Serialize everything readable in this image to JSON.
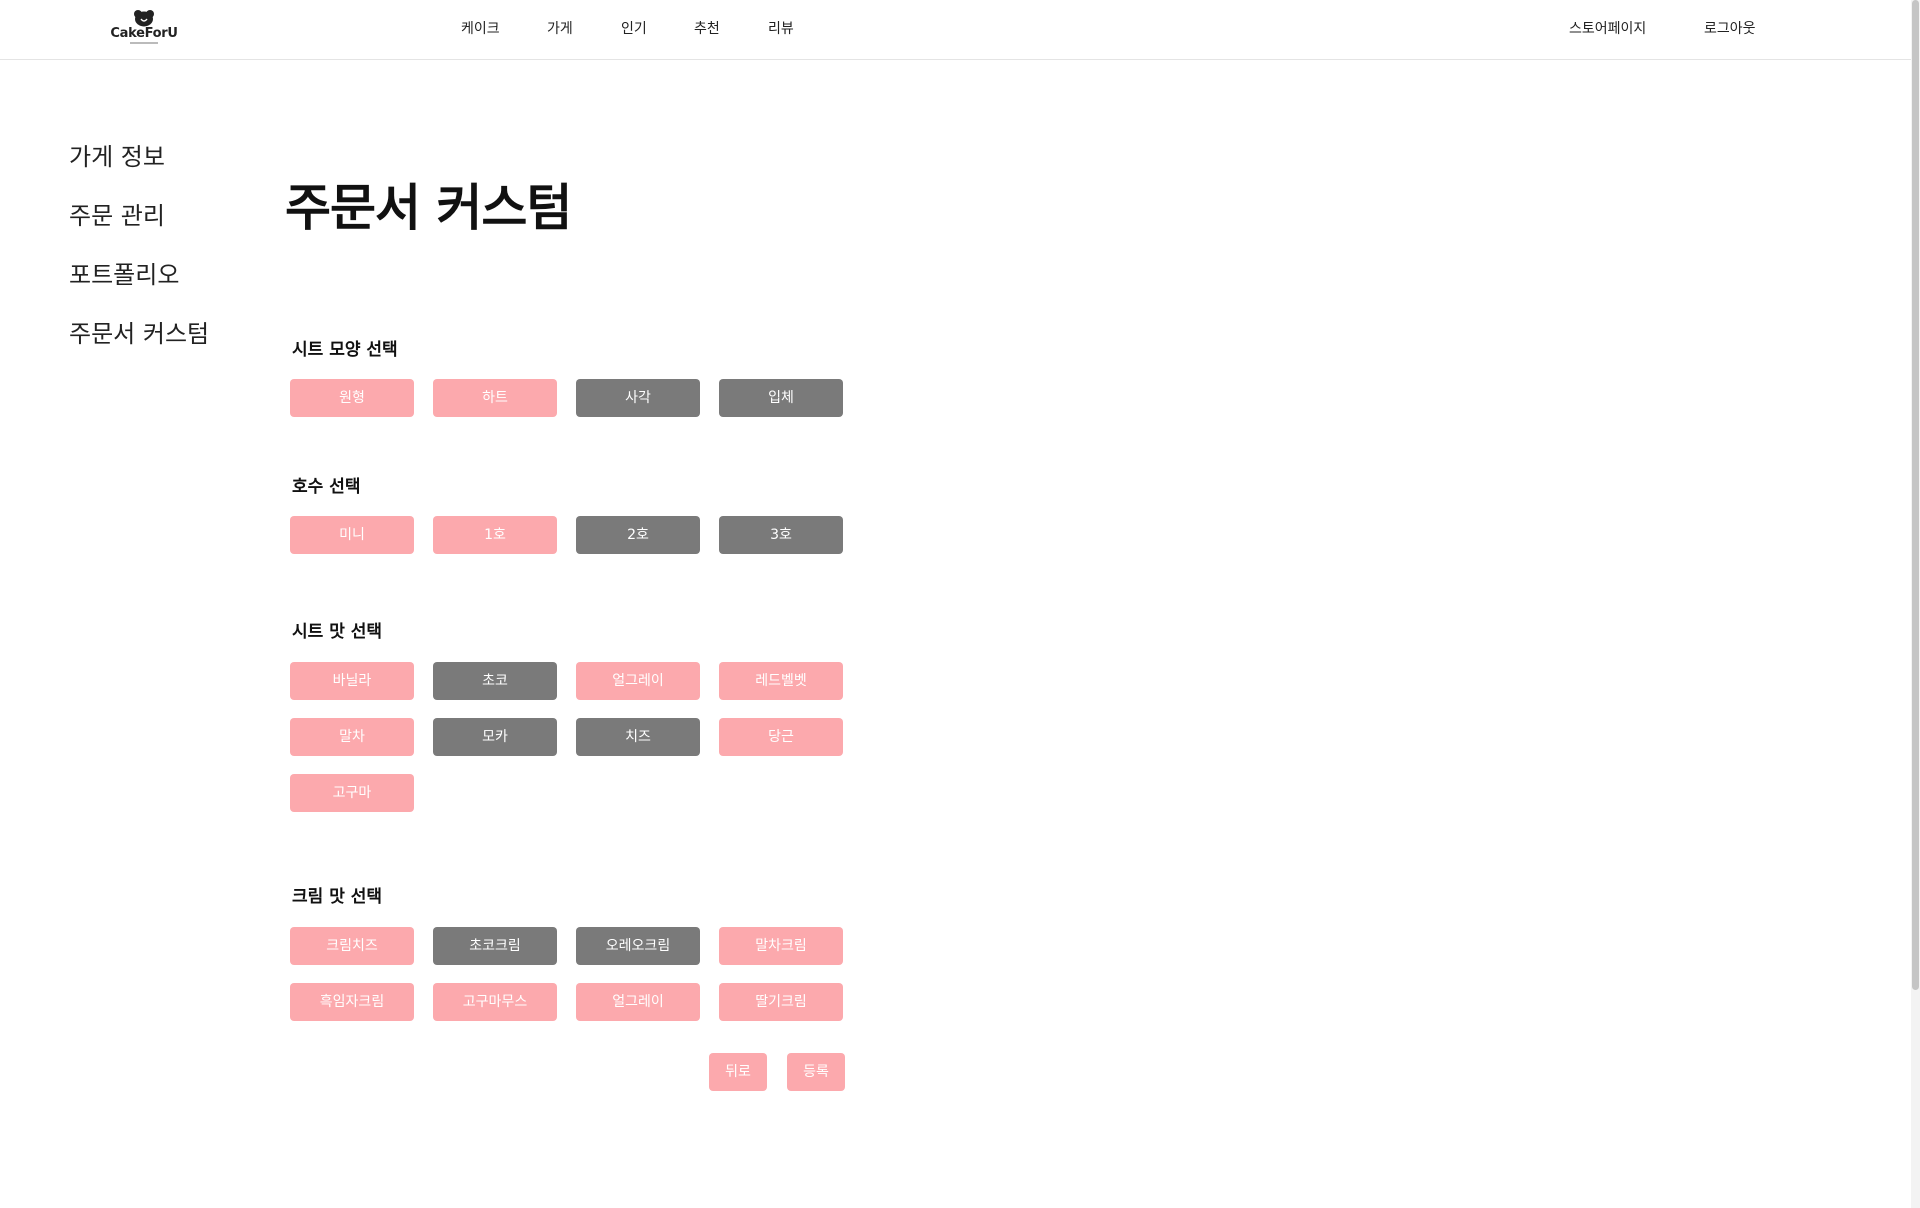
{
  "header": {
    "logo_text": "CakeForU",
    "nav": [
      "케이크",
      "가게",
      "인기",
      "추천",
      "리뷰"
    ],
    "store_page": "스토어페이지",
    "logout": "로그아웃"
  },
  "sidebar": {
    "items": [
      {
        "label": "가게 정보"
      },
      {
        "label": "주문 관리"
      },
      {
        "label": "포트폴리오"
      },
      {
        "label": "주문서 커스텀"
      }
    ]
  },
  "main": {
    "title": "주문서 커스텀",
    "sections": [
      {
        "title": "시트 모양 선택",
        "options": [
          {
            "label": "원형",
            "state": "pink"
          },
          {
            "label": "하트",
            "state": "pink"
          },
          {
            "label": "사각",
            "state": "gray"
          },
          {
            "label": "입체",
            "state": "gray"
          }
        ]
      },
      {
        "title": "호수 선택",
        "options": [
          {
            "label": "미니",
            "state": "pink"
          },
          {
            "label": "1호",
            "state": "pink"
          },
          {
            "label": "2호",
            "state": "gray"
          },
          {
            "label": "3호",
            "state": "gray"
          }
        ]
      },
      {
        "title": "시트 맛 선택",
        "options": [
          {
            "label": "바닐라",
            "state": "pink"
          },
          {
            "label": "초코",
            "state": "gray"
          },
          {
            "label": "얼그레이",
            "state": "pink"
          },
          {
            "label": "레드벨벳",
            "state": "pink"
          },
          {
            "label": "말차",
            "state": "pink"
          },
          {
            "label": "모카",
            "state": "gray"
          },
          {
            "label": "치즈",
            "state": "gray"
          },
          {
            "label": "당근",
            "state": "pink"
          },
          {
            "label": "고구마",
            "state": "pink"
          }
        ]
      },
      {
        "title": "크림 맛 선택",
        "options": [
          {
            "label": "크림치즈",
            "state": "pink"
          },
          {
            "label": "초코크림",
            "state": "gray"
          },
          {
            "label": "오레오크림",
            "state": "gray"
          },
          {
            "label": "말차크림",
            "state": "pink"
          },
          {
            "label": "흑임자크림",
            "state": "pink"
          },
          {
            "label": "고구마무스",
            "state": "pink"
          },
          {
            "label": "얼그레이",
            "state": "pink"
          },
          {
            "label": "딸기크림",
            "state": "pink"
          }
        ]
      }
    ],
    "actions": {
      "back": "뒤로",
      "submit": "등록"
    }
  },
  "colors": {
    "selected": "#fca9ad",
    "unselected": "#7a7a7a"
  }
}
